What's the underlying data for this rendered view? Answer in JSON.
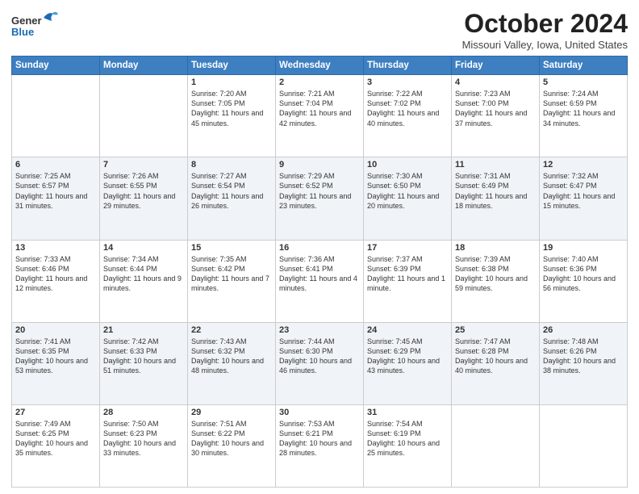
{
  "header": {
    "logo_line1": "General",
    "logo_line2": "Blue",
    "month": "October 2024",
    "location": "Missouri Valley, Iowa, United States"
  },
  "days_of_week": [
    "Sunday",
    "Monday",
    "Tuesday",
    "Wednesday",
    "Thursday",
    "Friday",
    "Saturday"
  ],
  "weeks": [
    [
      {
        "day": "",
        "sunrise": "",
        "sunset": "",
        "daylight": ""
      },
      {
        "day": "",
        "sunrise": "",
        "sunset": "",
        "daylight": ""
      },
      {
        "day": "1",
        "sunrise": "Sunrise: 7:20 AM",
        "sunset": "Sunset: 7:05 PM",
        "daylight": "Daylight: 11 hours and 45 minutes."
      },
      {
        "day": "2",
        "sunrise": "Sunrise: 7:21 AM",
        "sunset": "Sunset: 7:04 PM",
        "daylight": "Daylight: 11 hours and 42 minutes."
      },
      {
        "day": "3",
        "sunrise": "Sunrise: 7:22 AM",
        "sunset": "Sunset: 7:02 PM",
        "daylight": "Daylight: 11 hours and 40 minutes."
      },
      {
        "day": "4",
        "sunrise": "Sunrise: 7:23 AM",
        "sunset": "Sunset: 7:00 PM",
        "daylight": "Daylight: 11 hours and 37 minutes."
      },
      {
        "day": "5",
        "sunrise": "Sunrise: 7:24 AM",
        "sunset": "Sunset: 6:59 PM",
        "daylight": "Daylight: 11 hours and 34 minutes."
      }
    ],
    [
      {
        "day": "6",
        "sunrise": "Sunrise: 7:25 AM",
        "sunset": "Sunset: 6:57 PM",
        "daylight": "Daylight: 11 hours and 31 minutes."
      },
      {
        "day": "7",
        "sunrise": "Sunrise: 7:26 AM",
        "sunset": "Sunset: 6:55 PM",
        "daylight": "Daylight: 11 hours and 29 minutes."
      },
      {
        "day": "8",
        "sunrise": "Sunrise: 7:27 AM",
        "sunset": "Sunset: 6:54 PM",
        "daylight": "Daylight: 11 hours and 26 minutes."
      },
      {
        "day": "9",
        "sunrise": "Sunrise: 7:29 AM",
        "sunset": "Sunset: 6:52 PM",
        "daylight": "Daylight: 11 hours and 23 minutes."
      },
      {
        "day": "10",
        "sunrise": "Sunrise: 7:30 AM",
        "sunset": "Sunset: 6:50 PM",
        "daylight": "Daylight: 11 hours and 20 minutes."
      },
      {
        "day": "11",
        "sunrise": "Sunrise: 7:31 AM",
        "sunset": "Sunset: 6:49 PM",
        "daylight": "Daylight: 11 hours and 18 minutes."
      },
      {
        "day": "12",
        "sunrise": "Sunrise: 7:32 AM",
        "sunset": "Sunset: 6:47 PM",
        "daylight": "Daylight: 11 hours and 15 minutes."
      }
    ],
    [
      {
        "day": "13",
        "sunrise": "Sunrise: 7:33 AM",
        "sunset": "Sunset: 6:46 PM",
        "daylight": "Daylight: 11 hours and 12 minutes."
      },
      {
        "day": "14",
        "sunrise": "Sunrise: 7:34 AM",
        "sunset": "Sunset: 6:44 PM",
        "daylight": "Daylight: 11 hours and 9 minutes."
      },
      {
        "day": "15",
        "sunrise": "Sunrise: 7:35 AM",
        "sunset": "Sunset: 6:42 PM",
        "daylight": "Daylight: 11 hours and 7 minutes."
      },
      {
        "day": "16",
        "sunrise": "Sunrise: 7:36 AM",
        "sunset": "Sunset: 6:41 PM",
        "daylight": "Daylight: 11 hours and 4 minutes."
      },
      {
        "day": "17",
        "sunrise": "Sunrise: 7:37 AM",
        "sunset": "Sunset: 6:39 PM",
        "daylight": "Daylight: 11 hours and 1 minute."
      },
      {
        "day": "18",
        "sunrise": "Sunrise: 7:39 AM",
        "sunset": "Sunset: 6:38 PM",
        "daylight": "Daylight: 10 hours and 59 minutes."
      },
      {
        "day": "19",
        "sunrise": "Sunrise: 7:40 AM",
        "sunset": "Sunset: 6:36 PM",
        "daylight": "Daylight: 10 hours and 56 minutes."
      }
    ],
    [
      {
        "day": "20",
        "sunrise": "Sunrise: 7:41 AM",
        "sunset": "Sunset: 6:35 PM",
        "daylight": "Daylight: 10 hours and 53 minutes."
      },
      {
        "day": "21",
        "sunrise": "Sunrise: 7:42 AM",
        "sunset": "Sunset: 6:33 PM",
        "daylight": "Daylight: 10 hours and 51 minutes."
      },
      {
        "day": "22",
        "sunrise": "Sunrise: 7:43 AM",
        "sunset": "Sunset: 6:32 PM",
        "daylight": "Daylight: 10 hours and 48 minutes."
      },
      {
        "day": "23",
        "sunrise": "Sunrise: 7:44 AM",
        "sunset": "Sunset: 6:30 PM",
        "daylight": "Daylight: 10 hours and 46 minutes."
      },
      {
        "day": "24",
        "sunrise": "Sunrise: 7:45 AM",
        "sunset": "Sunset: 6:29 PM",
        "daylight": "Daylight: 10 hours and 43 minutes."
      },
      {
        "day": "25",
        "sunrise": "Sunrise: 7:47 AM",
        "sunset": "Sunset: 6:28 PM",
        "daylight": "Daylight: 10 hours and 40 minutes."
      },
      {
        "day": "26",
        "sunrise": "Sunrise: 7:48 AM",
        "sunset": "Sunset: 6:26 PM",
        "daylight": "Daylight: 10 hours and 38 minutes."
      }
    ],
    [
      {
        "day": "27",
        "sunrise": "Sunrise: 7:49 AM",
        "sunset": "Sunset: 6:25 PM",
        "daylight": "Daylight: 10 hours and 35 minutes."
      },
      {
        "day": "28",
        "sunrise": "Sunrise: 7:50 AM",
        "sunset": "Sunset: 6:23 PM",
        "daylight": "Daylight: 10 hours and 33 minutes."
      },
      {
        "day": "29",
        "sunrise": "Sunrise: 7:51 AM",
        "sunset": "Sunset: 6:22 PM",
        "daylight": "Daylight: 10 hours and 30 minutes."
      },
      {
        "day": "30",
        "sunrise": "Sunrise: 7:53 AM",
        "sunset": "Sunset: 6:21 PM",
        "daylight": "Daylight: 10 hours and 28 minutes."
      },
      {
        "day": "31",
        "sunrise": "Sunrise: 7:54 AM",
        "sunset": "Sunset: 6:19 PM",
        "daylight": "Daylight: 10 hours and 25 minutes."
      },
      {
        "day": "",
        "sunrise": "",
        "sunset": "",
        "daylight": ""
      },
      {
        "day": "",
        "sunrise": "",
        "sunset": "",
        "daylight": ""
      }
    ]
  ]
}
